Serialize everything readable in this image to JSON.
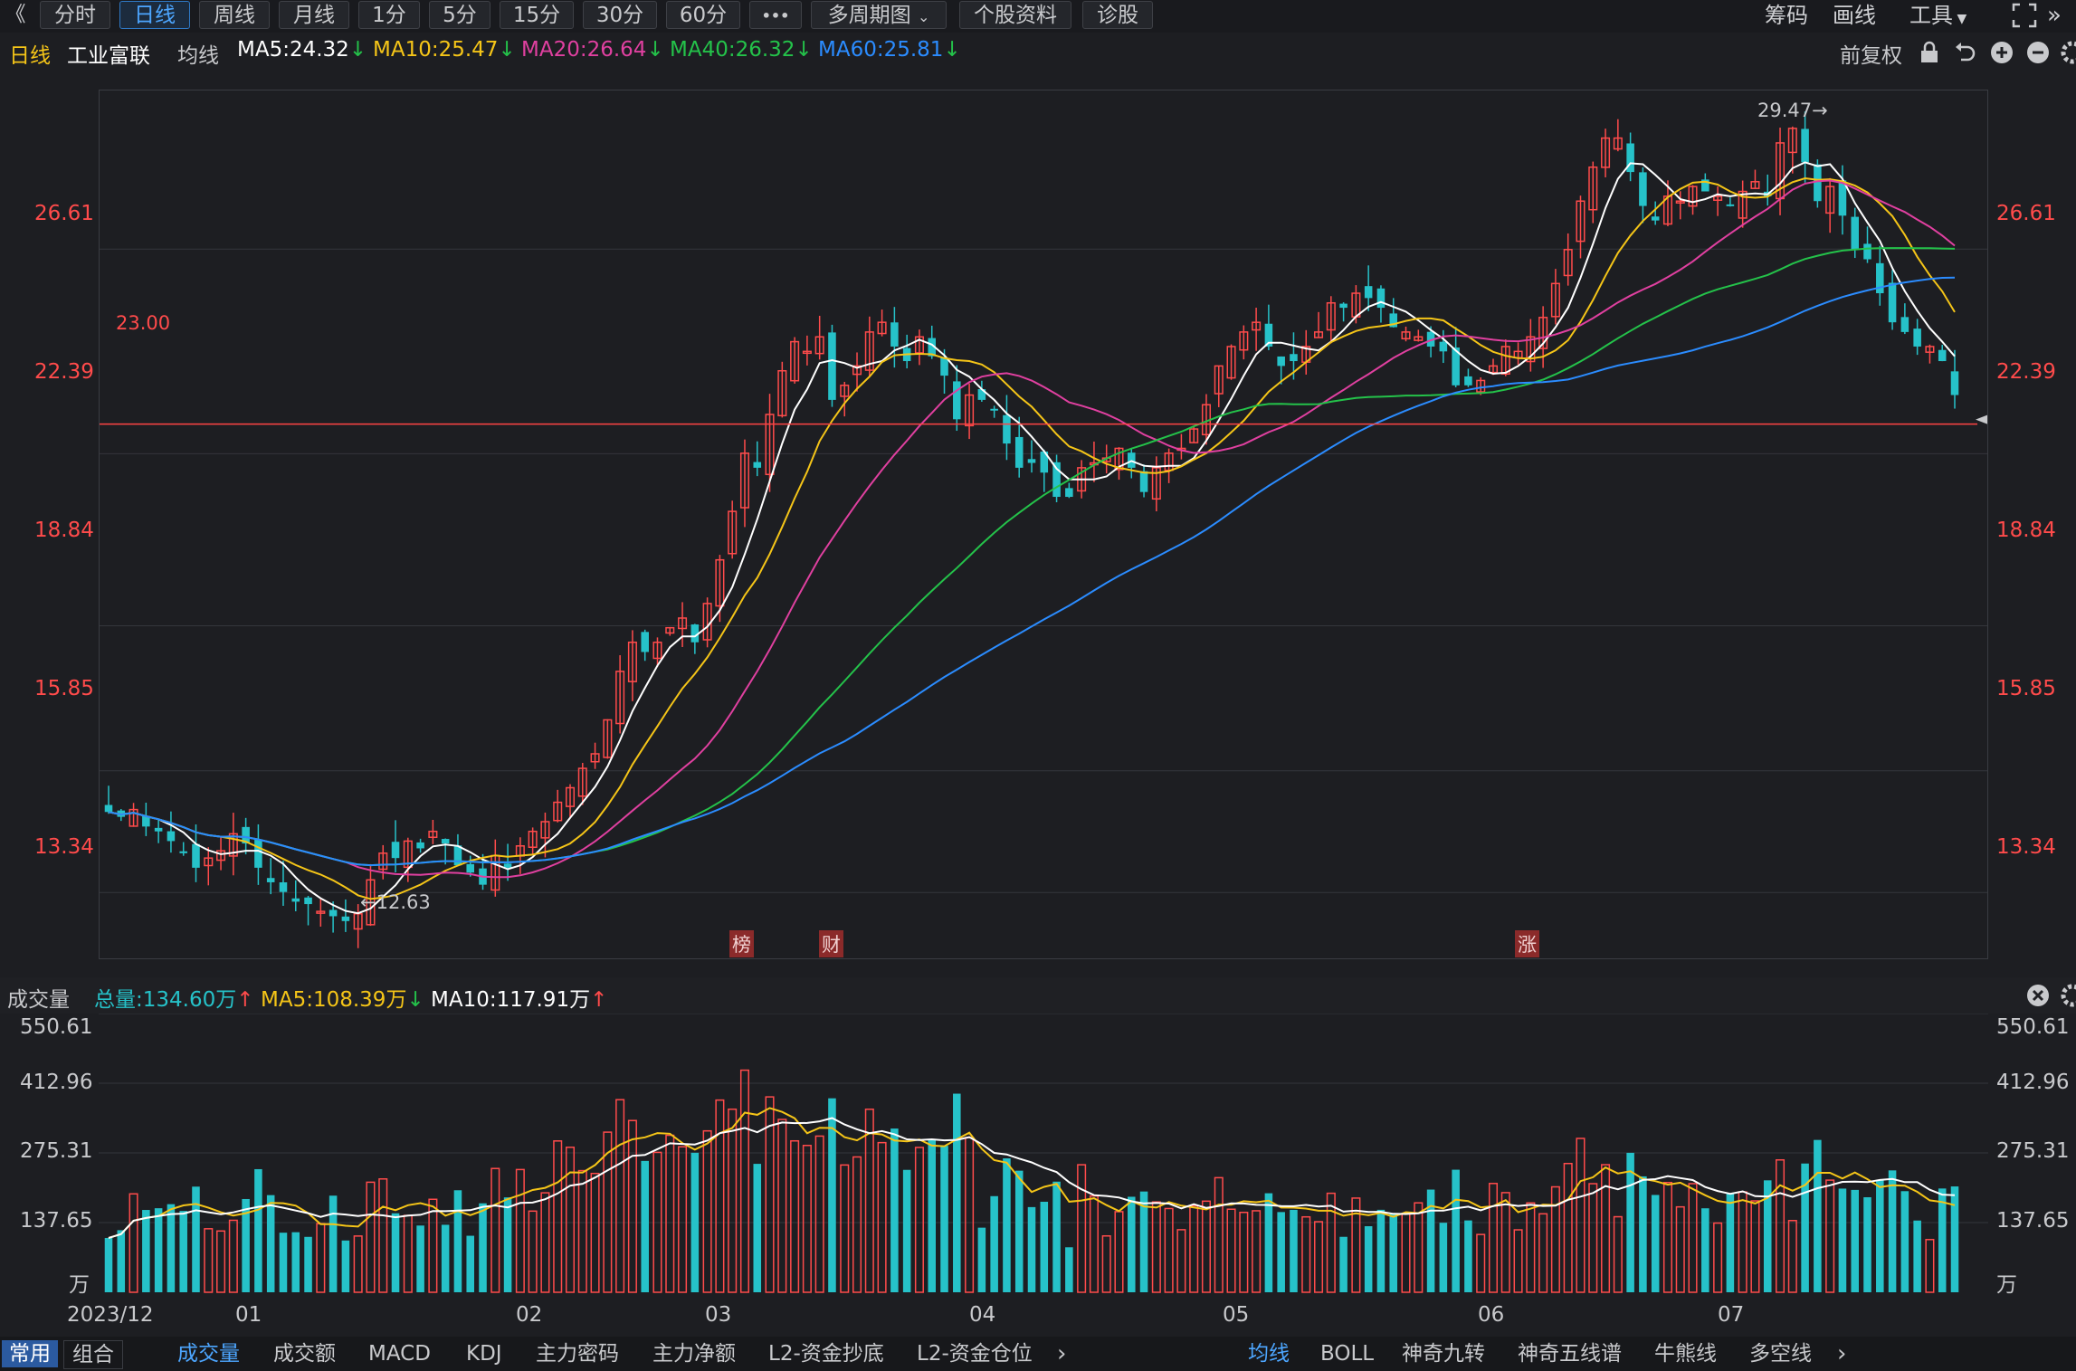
{
  "toolbar": {
    "back": "《",
    "periods": [
      "分时",
      "日线",
      "周线",
      "月线",
      "1分",
      "5分",
      "15分",
      "30分",
      "60分"
    ],
    "more": "•••",
    "multi": "多周期图",
    "info": "个股资料",
    "diag": "诊股",
    "right": [
      "筹码",
      "画线",
      "工具"
    ]
  },
  "indicator_bar": {
    "period": "日线",
    "stock": "工业富联",
    "ma_label": "均线",
    "ma5": "MA5:24.32",
    "ma10": "MA10:25.47",
    "ma20": "MA20:26.64",
    "ma40": "MA40:26.32",
    "ma60": "MA60:25.81",
    "adjust": "前复权"
  },
  "volume_bar": {
    "title": "成交量",
    "total": "总量:134.60万",
    "ma5": "MA5:108.39万",
    "ma10": "MA10:117.91万"
  },
  "bottom": {
    "left": [
      "常用",
      "组合"
    ],
    "tabs": [
      "成交量",
      "成交额",
      "MACD",
      "KDJ",
      "主力密码",
      "主力净额",
      "L2-资金抄底",
      "L2-资金仓位"
    ],
    "right": [
      "均线",
      "BOLL",
      "神奇九转",
      "神奇五线谱",
      "牛熊线",
      "多空线"
    ]
  },
  "colors": {
    "up": "#ff4b4b",
    "down": "#26c2c9",
    "ma5": "#ffffff",
    "ma10": "#f5c518",
    "ma20": "#e040a0",
    "ma40": "#24c24a",
    "ma60": "#2b8cff",
    "hline": "#ff4444"
  },
  "chart_data": [
    {
      "type": "candlestick",
      "title": "工业富联 日线",
      "price_ticks": [
        "26.61",
        "22.39",
        "18.84",
        "15.85",
        "13.34"
      ],
      "x_ticks": [
        "2023/12",
        "01",
        "02",
        "03",
        "04",
        "05",
        "06",
        "07"
      ],
      "ylim": [
        12.0,
        29.9
      ],
      "horizontal_line": {
        "value": 23.0,
        "label": "23.00"
      },
      "annotations": {
        "high": "29.47→",
        "low": "←12.63",
        "markers": [
          "榜",
          "财",
          "涨"
        ]
      },
      "close": [
        15.0,
        14.9,
        15.05,
        14.7,
        14.6,
        14.4,
        14.15,
        13.85,
        14.05,
        14.2,
        14.55,
        14.35,
        13.85,
        13.55,
        13.35,
        13.15,
        13.1,
        12.95,
        12.85,
        12.75,
        12.9,
        13.6,
        14.15,
        14.05,
        14.4,
        14.25,
        14.6,
        14.35,
        13.9,
        13.75,
        13.5,
        14.1,
        13.85,
        14.3,
        14.6,
        14.8,
        15.2,
        15.5,
        15.9,
        16.2,
        16.9,
        17.9,
        18.5,
        18.3,
        18.5,
        18.8,
        19.0,
        18.5,
        19.3,
        20.2,
        21.2,
        22.4,
        22.1,
        23.2,
        24.1,
        24.7,
        24.5,
        24.8,
        23.5,
        23.8,
        24.2,
        24.9,
        25.1,
        24.6,
        24.3,
        24.8,
        24.4,
        24.0,
        23.1,
        23.6,
        23.5,
        23.3,
        22.6,
        22.1,
        22.2,
        22.0,
        21.5,
        21.5,
        22.1,
        22.2,
        22.3,
        22.5,
        22.1,
        21.6,
        22.1,
        22.4,
        22.5,
        22.9,
        23.4,
        24.2,
        24.6,
        24.9,
        25.1,
        24.6,
        24.2,
        24.3,
        24.6,
        24.9,
        25.5,
        25.4,
        25.7,
        25.6,
        25.4,
        25.0,
        24.9,
        24.8,
        24.6,
        24.5,
        23.8,
        23.8,
        23.9,
        24.2,
        24.6,
        24.5,
        24.8,
        25.2,
        25.9,
        26.6,
        27.6,
        28.3,
        28.9,
        28.9,
        28.2,
        27.5,
        27.2,
        27.7,
        27.6,
        27.9,
        27.8,
        27.7,
        27.5,
        27.8,
        28.0,
        27.7,
        28.8,
        29.1,
        28.4,
        27.6,
        27.9,
        27.3,
        26.6,
        26.4,
        25.7,
        25.1,
        24.9,
        24.6,
        24.6,
        24.3,
        23.6
      ],
      "volume_ticks": [
        "550.61",
        "412.96",
        "275.31",
        "137.65"
      ],
      "volume_unit": "万",
      "volume_ylim": [
        0,
        550.61
      ]
    }
  ]
}
